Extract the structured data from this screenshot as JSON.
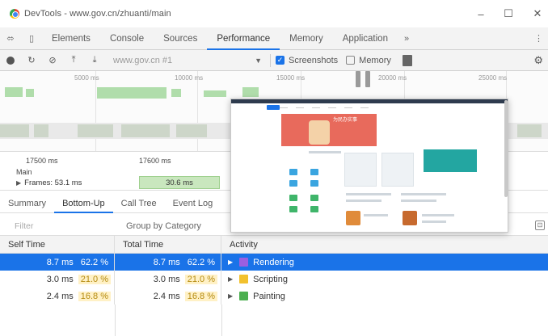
{
  "window": {
    "title": "DevTools - www.gov.cn/zhuanti/main"
  },
  "tabs": [
    "Elements",
    "Console",
    "Sources",
    "Performance",
    "Memory",
    "Application"
  ],
  "active_tab": "Performance",
  "toolbar": {
    "url": "www.gov.cn #1",
    "screenshots_label": "Screenshots",
    "memory_label": "Memory"
  },
  "overview": {
    "ticks": [
      "5000 ms",
      "10000 ms",
      "15000 ms",
      "20000 ms",
      "25000 ms"
    ]
  },
  "timeline": {
    "ticks": [
      "17500 ms",
      "17600 ms"
    ],
    "frames_label": "Frames: 53.1 ms",
    "frame_box": "30.6 ms",
    "row2": "Main"
  },
  "subtabs": [
    "Summary",
    "Bottom-Up",
    "Call Tree",
    "Event Log"
  ],
  "active_subtab": "Bottom-Up",
  "filter": {
    "placeholder": "Filter",
    "group_by": "Group by Category"
  },
  "columns": {
    "self": "Self Time",
    "total": "Total Time",
    "activity": "Activity"
  },
  "rows": [
    {
      "self_ms": "8.7 ms",
      "self_pct": "62.2 %",
      "total_ms": "8.7 ms",
      "total_pct": "62.2 %",
      "activity": "Rendering",
      "color": "#9b5fe0",
      "selected": true
    },
    {
      "self_ms": "3.0 ms",
      "self_pct": "21.0 %",
      "total_ms": "3.0 ms",
      "total_pct": "21.0 %",
      "activity": "Scripting",
      "color": "#f2c12e",
      "selected": false
    },
    {
      "self_ms": "2.4 ms",
      "self_pct": "16.8 %",
      "total_ms": "2.4 ms",
      "total_pct": "16.8 %",
      "activity": "Painting",
      "color": "#4caf50",
      "selected": false
    }
  ],
  "thumbnail": {
    "hero_text": "为民办实事"
  }
}
